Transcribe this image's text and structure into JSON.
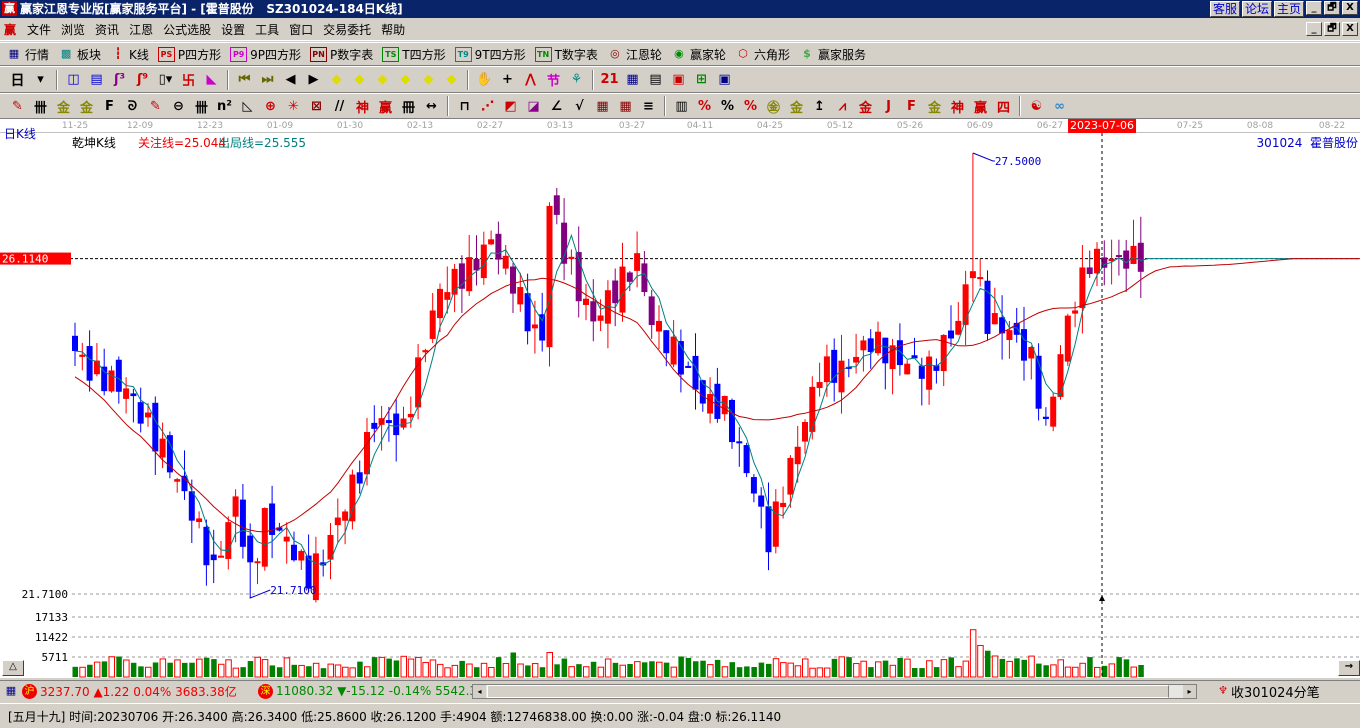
{
  "window": {
    "title": "赢家江恩专业版[赢家服务平台] - [霍普股份   SZ301024-184日K线]",
    "logo": "赢",
    "links": [
      "客服",
      "论坛",
      "主页"
    ],
    "controls": [
      "_",
      "🗗",
      "X"
    ]
  },
  "menu": {
    "logo": "赢",
    "items": [
      "文件",
      "浏览",
      "资讯",
      "江恩",
      "公式选股",
      "设置",
      "工具",
      "窗口",
      "交易委托",
      "帮助"
    ]
  },
  "toolbar1": [
    {
      "name": "quotes",
      "icon": "▦",
      "box": false,
      "color": "#000080",
      "label": "行情"
    },
    {
      "name": "sectors",
      "icon": "▩",
      "box": false,
      "color": "#008080",
      "label": "板块"
    },
    {
      "name": "kline",
      "icon": "┇",
      "box": false,
      "color": "#c00",
      "label": "K线"
    },
    {
      "name": "p-square",
      "icon": "PS",
      "box": true,
      "color": "#c00",
      "label": "P四方形"
    },
    {
      "name": "9p-square",
      "icon": "P9",
      "box": true,
      "color": "#c0c",
      "label": "9P四方形"
    },
    {
      "name": "p-number-table",
      "icon": "PN",
      "box": true,
      "color": "#800",
      "label": "P数字表"
    },
    {
      "name": "t-square",
      "icon": "TS",
      "box": true,
      "color": "#080",
      "label": "T四方形"
    },
    {
      "name": "9t-square",
      "icon": "T9",
      "box": true,
      "color": "#088",
      "label": "9T四方形"
    },
    {
      "name": "t-number-table",
      "icon": "TN",
      "box": true,
      "color": "#080",
      "label": "T数字表"
    },
    {
      "name": "gann-wheel",
      "icon": "◎",
      "box": false,
      "color": "#800",
      "label": "江恩轮"
    },
    {
      "name": "winner-wheel",
      "icon": "◉",
      "box": false,
      "color": "#080",
      "label": "赢家轮"
    },
    {
      "name": "hexagon",
      "icon": "⬡",
      "box": false,
      "color": "#c00",
      "label": "六角形"
    },
    {
      "name": "winner-service",
      "icon": "$",
      "box": false,
      "color": "#4a4",
      "label": "赢家服务"
    }
  ],
  "toolbar2": {
    "period": "日",
    "icons": [
      {
        "name": "period-dropdown",
        "g": "▾",
        "c": "#000"
      },
      {
        "name": "sep"
      },
      {
        "name": "chart-style",
        "g": "◫",
        "c": "#00c"
      },
      {
        "name": "notes",
        "g": "▤",
        "c": "#00c"
      },
      {
        "name": "wave-3",
        "g": "ʃ³",
        "c": "#808"
      },
      {
        "name": "wave-9",
        "g": "ʃ⁹",
        "c": "#c00"
      },
      {
        "name": "candle-type",
        "g": "▯▾",
        "c": "#000"
      },
      {
        "name": "gann-tool",
        "g": "卐",
        "c": "#c00"
      },
      {
        "name": "fan",
        "g": "◣",
        "c": "#c0c"
      },
      {
        "name": "sep"
      },
      {
        "name": "first",
        "g": "⏮",
        "c": "#660"
      },
      {
        "name": "last",
        "g": "⏭",
        "c": "#660"
      },
      {
        "name": "left",
        "g": "◀",
        "c": "#000"
      },
      {
        "name": "right",
        "g": "▶",
        "c": "#000"
      },
      {
        "name": "move-left",
        "g": "◆",
        "c": "#dd0"
      },
      {
        "name": "move-right",
        "g": "◆",
        "c": "#dd0"
      },
      {
        "name": "zoom-h",
        "g": "◆",
        "c": "#dd0"
      },
      {
        "name": "zoom-in",
        "g": "◆",
        "c": "#dd0"
      },
      {
        "name": "zoom-out",
        "g": "◆",
        "c": "#dd0"
      },
      {
        "name": "zoom-v",
        "g": "◆",
        "c": "#dd0"
      },
      {
        "name": "sep"
      },
      {
        "name": "hand",
        "g": "✋",
        "c": "#000"
      },
      {
        "name": "crosshair",
        "g": "+",
        "c": "#000"
      },
      {
        "name": "line-draw",
        "g": "⋀",
        "c": "#c00"
      },
      {
        "name": "festival",
        "g": "节",
        "c": "#c0c"
      },
      {
        "name": "shape",
        "g": "⚘",
        "c": "#088"
      },
      {
        "name": "sep"
      },
      {
        "name": "calendar",
        "g": "21",
        "c": "#c00"
      },
      {
        "name": "calculator",
        "g": "▦",
        "c": "#008"
      },
      {
        "name": "document",
        "g": "▤",
        "c": "#000"
      },
      {
        "name": "save",
        "g": "▣",
        "c": "#c00"
      },
      {
        "name": "network",
        "g": "⊞",
        "c": "#080"
      },
      {
        "name": "computer",
        "g": "▣",
        "c": "#008"
      }
    ]
  },
  "toolbar3": [
    {
      "name": "pen",
      "g": "✎",
      "c": "#c00"
    },
    {
      "name": "lines-3",
      "g": "卌",
      "c": "#000"
    },
    {
      "name": "gold-1",
      "g": "金",
      "c": "#880"
    },
    {
      "name": "gold-2",
      "g": "金",
      "c": "#880"
    },
    {
      "name": "f-lines",
      "g": "F",
      "c": "#000"
    },
    {
      "name": "spiral",
      "g": "ᘐ",
      "c": "#000"
    },
    {
      "name": "pen-grid",
      "g": "✎",
      "c": "#c00"
    },
    {
      "name": "circle-lines",
      "g": "⊖",
      "c": "#000"
    },
    {
      "name": "parallel",
      "g": "卌",
      "c": "#000"
    },
    {
      "name": "n-squared",
      "g": "n²",
      "c": "#000"
    },
    {
      "name": "triangle",
      "g": "◺",
      "c": "#000"
    },
    {
      "name": "target",
      "g": "⊕",
      "c": "#c00"
    },
    {
      "name": "star",
      "g": "✳",
      "c": "#c00"
    },
    {
      "name": "square-grid",
      "g": "⊠",
      "c": "#800"
    },
    {
      "name": "angles",
      "g": "//",
      "c": "#000"
    },
    {
      "name": "shen",
      "g": "神",
      "c": "#c00"
    },
    {
      "name": "ying",
      "g": "赢",
      "c": "#c00"
    },
    {
      "name": "columns",
      "g": "冊",
      "c": "#000"
    },
    {
      "name": "measure",
      "g": "↔",
      "c": "#000"
    },
    {
      "name": "sep"
    },
    {
      "name": "box-line",
      "g": "⊓",
      "c": "#000"
    },
    {
      "name": "fan-red",
      "g": "⋰",
      "c": "#c00"
    },
    {
      "name": "fan-box",
      "g": "◩",
      "c": "#c00"
    },
    {
      "name": "fan-box-2",
      "g": "◪",
      "c": "#808"
    },
    {
      "name": "angle",
      "g": "∠",
      "c": "#000"
    },
    {
      "name": "v-line",
      "g": "√",
      "c": "#000"
    },
    {
      "name": "grid-1",
      "g": "▦",
      "c": "#800"
    },
    {
      "name": "grid-2",
      "g": "▦",
      "c": "#800"
    },
    {
      "name": "slants",
      "g": "≡",
      "c": "#000"
    },
    {
      "name": "sep"
    },
    {
      "name": "table",
      "g": "▥",
      "c": "#000"
    },
    {
      "name": "percent-fan",
      "g": "%",
      "c": "#c00"
    },
    {
      "name": "percent",
      "g": "%",
      "c": "#000"
    },
    {
      "name": "percent-lines",
      "g": "%",
      "c": "#c00"
    },
    {
      "name": "gold-circle",
      "g": "㊎",
      "c": "#880"
    },
    {
      "name": "gold-lines",
      "g": "金",
      "c": "#880"
    },
    {
      "name": "arrow-tool",
      "g": "↥",
      "c": "#000"
    },
    {
      "name": "wave-box",
      "g": "⩘",
      "c": "#c00"
    },
    {
      "name": "gold-box",
      "g": "金",
      "c": "#c00"
    },
    {
      "name": "j-fan",
      "g": "J",
      "c": "#c00"
    },
    {
      "name": "f-fan",
      "g": "F",
      "c": "#c00"
    },
    {
      "name": "gold-fan",
      "g": "金",
      "c": "#880"
    },
    {
      "name": "shen-fan",
      "g": "神",
      "c": "#c00"
    },
    {
      "name": "ying-fan",
      "g": "赢",
      "c": "#c00"
    },
    {
      "name": "si-fan",
      "g": "四",
      "c": "#c00"
    },
    {
      "name": "sep"
    },
    {
      "name": "yin-yang",
      "g": "☯",
      "c": "#c00"
    },
    {
      "name": "infinity",
      "g": "∞",
      "c": "#38c"
    }
  ],
  "datebar": {
    "ticks": [
      "11-25",
      "12-09",
      "12-23",
      "01-09",
      "01-30",
      "02-13",
      "02-27",
      "03-13",
      "03-27",
      "04-11",
      "04-25",
      "05-12",
      "05-26",
      "06-09",
      "06-27",
      "07-25",
      "08-08",
      "08-22"
    ],
    "highlight": "2023-07-06"
  },
  "chart_header": {
    "period_label": "日K线",
    "indicator": "乾坤K线",
    "focus_line": "关注线=25.044",
    "exit_line": "出局线=25.555",
    "stock": "301024  霍普股份"
  },
  "chart_data": {
    "type": "candlestick",
    "price_axis": {
      "top_label": "27.5000",
      "low_label": "21.7100",
      "current": "26.1140",
      "max": 27.5,
      "min": 21.71,
      "current_value": 26.114
    },
    "volume_axis": {
      "labels": [
        "17133",
        "11422",
        "5711"
      ],
      "values": [
        17133,
        11422,
        5711
      ]
    },
    "keypoints": [
      [
        0,
        24.9
      ],
      [
        2,
        24.65
      ],
      [
        7,
        24.4
      ],
      [
        12,
        23.6
      ],
      [
        16,
        22.8
      ],
      [
        19,
        22.0
      ],
      [
        22,
        22.94
      ],
      [
        24,
        21.96
      ],
      [
        26,
        22.68
      ],
      [
        29,
        22.42
      ],
      [
        32,
        21.96
      ],
      [
        34,
        22.2
      ],
      [
        36,
        22.68
      ],
      [
        39,
        23.34
      ],
      [
        41,
        24.0
      ],
      [
        45,
        23.86
      ],
      [
        48,
        25.04
      ],
      [
        50,
        25.7
      ],
      [
        54,
        25.96
      ],
      [
        57,
        26.36
      ],
      [
        60,
        25.83
      ],
      [
        62,
        25.3
      ],
      [
        64,
        25.04
      ],
      [
        65,
        26.88
      ],
      [
        67,
        26.22
      ],
      [
        69,
        25.7
      ],
      [
        71,
        25.3
      ],
      [
        74,
        25.7
      ],
      [
        77,
        26.09
      ],
      [
        79,
        25.3
      ],
      [
        82,
        24.91
      ],
      [
        86,
        24.26
      ],
      [
        89,
        24.13
      ],
      [
        93,
        23.07
      ],
      [
        95,
        22.42
      ],
      [
        97,
        23.07
      ],
      [
        100,
        24.0
      ],
      [
        102,
        24.65
      ],
      [
        105,
        24.65
      ],
      [
        109,
        25.04
      ],
      [
        113,
        24.78
      ],
      [
        117,
        24.65
      ],
      [
        121,
        25.3
      ],
      [
        123,
        26.09
      ],
      [
        125,
        25.3
      ],
      [
        128,
        25.17
      ],
      [
        131,
        24.78
      ],
      [
        133,
        23.86
      ],
      [
        134,
        24.39
      ],
      [
        136,
        25.3
      ],
      [
        139,
        26.09
      ],
      [
        142,
        26.09
      ],
      [
        146,
        26.12
      ]
    ],
    "peak_annotation": {
      "index": 123,
      "value": 27.5
    },
    "low_annotation": {
      "index": 24,
      "value": 21.71
    },
    "series": [
      {
        "name": "关注线",
        "color": "#008080"
      },
      {
        "name": "出局线",
        "color": "#c00000"
      }
    ],
    "colors": {
      "up": "#ff0000",
      "down": "#0000ff",
      "neutral": "#800080",
      "vol_up": "#ff0000",
      "vol_down": "#008000"
    }
  },
  "status": {
    "sh_badge": "沪",
    "sh_text": "3237.70 ▲1.22 0.04% 3683.38亿",
    "sz_badge": "深",
    "sz_text": "11080.32 ▼-15.12 -0.14% 5542.3",
    "tick_label": "收301024分笔"
  },
  "info": "[五月十九] 时间:20230706 开:26.3400 高:26.3400 低:25.8600 收:26.1200 手:4904 额:12746838.00 换:0.00 涨:-0.04 盘:0 标:26.1140"
}
